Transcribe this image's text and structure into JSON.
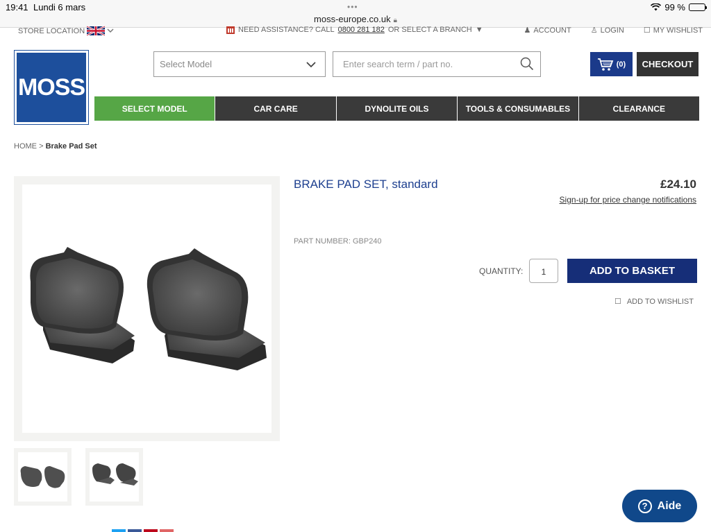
{
  "status_bar": {
    "time": "19:41",
    "date": "Lundi 6 mars",
    "url": "moss-europe.co.uk",
    "battery": "99 %",
    "battery_level": 0.99
  },
  "utility": {
    "store_location": "STORE LOCATION",
    "assist_prefix": "NEED ASSISTANCE? CALL",
    "phone": "0800 281 182",
    "assist_suffix": "OR SELECT A BRANCH",
    "account": "ACCOUNT",
    "login": "LOGIN",
    "wishlist": "MY WISHLIST"
  },
  "header": {
    "logo": "MOSS",
    "select_model_placeholder": "Select Model",
    "search_placeholder": "Enter search term / part no.",
    "cart_count": "(0)",
    "checkout": "CHECKOUT"
  },
  "nav": [
    "SELECT MODEL",
    "CAR CARE",
    "DYNOLITE OILS",
    "TOOLS & CONSUMABLES",
    "CLEARANCE"
  ],
  "breadcrumb": {
    "home": "HOME",
    "separator": ">",
    "current": "Brake Pad Set"
  },
  "product": {
    "title": "BRAKE PAD SET, standard",
    "price": "£24.10",
    "signup": "Sign-up for price change notifications",
    "part_number": "PART NUMBER: GBP240",
    "quantity_label": "QUANTITY:",
    "quantity": "1",
    "add_to_basket": "ADD TO BASKET",
    "add_to_wishlist": "ADD TO WISHLIST"
  },
  "help": {
    "label": "Aide"
  },
  "colors": {
    "brand_blue": "#1d4f9c",
    "nav_green": "#56a646",
    "nav_dark": "#3a3a3a",
    "basket_blue": "#162e78"
  }
}
